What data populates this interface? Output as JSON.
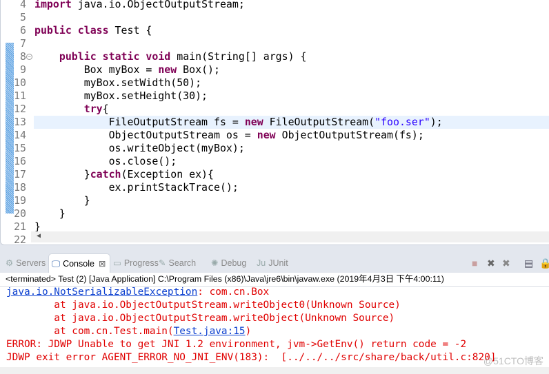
{
  "editor": {
    "current_line": 13,
    "lines": [
      {
        "n": "4",
        "segs": [
          [
            "kw",
            "import"
          ],
          [
            "",
            "java.io.ObjectOutputStream;"
          ]
        ],
        "sep": [
          " "
        ]
      },
      {
        "n": "5",
        "segs": []
      },
      {
        "n": "6",
        "segs": [
          [
            "kw",
            "public"
          ],
          [
            "",
            " "
          ],
          [
            "kw",
            "class"
          ],
          [
            "",
            " Test {"
          ]
        ]
      },
      {
        "n": "7",
        "segs": []
      },
      {
        "n": "8",
        "fold": true,
        "segs": [
          [
            "",
            "    "
          ],
          [
            "kw",
            "public"
          ],
          [
            "",
            " "
          ],
          [
            "kw",
            "static"
          ],
          [
            "",
            " "
          ],
          [
            "kw",
            "void"
          ],
          [
            "",
            " main(String[] args) {"
          ]
        ]
      },
      {
        "n": "9",
        "segs": [
          [
            "",
            "        Box myBox = "
          ],
          [
            "kw",
            "new"
          ],
          [
            "",
            " Box();"
          ]
        ]
      },
      {
        "n": "10",
        "segs": [
          [
            "",
            "        myBox.setWidth(50);"
          ]
        ]
      },
      {
        "n": "11",
        "segs": [
          [
            "",
            "        myBox.setHeight(30);"
          ]
        ]
      },
      {
        "n": "12",
        "segs": [
          [
            "",
            "        "
          ],
          [
            "kw",
            "try"
          ],
          [
            "",
            "{"
          ]
        ]
      },
      {
        "n": "13",
        "segs": [
          [
            "",
            "            FileOutputStream fs = "
          ],
          [
            "kw",
            "new"
          ],
          [
            "",
            " FileOutputStream("
          ],
          [
            "str",
            "\"foo.ser\""
          ],
          [
            "",
            ");"
          ]
        ]
      },
      {
        "n": "14",
        "segs": [
          [
            "",
            "            ObjectOutputStream os = "
          ],
          [
            "kw",
            "new"
          ],
          [
            "",
            " ObjectOutputStream(fs);"
          ]
        ]
      },
      {
        "n": "15",
        "segs": [
          [
            "",
            "            os.writeObject(myBox);"
          ]
        ]
      },
      {
        "n": "16",
        "segs": [
          [
            "",
            "            os.close();"
          ]
        ]
      },
      {
        "n": "17",
        "segs": [
          [
            "",
            "        }"
          ],
          [
            "kw",
            "catch"
          ],
          [
            "",
            "(Exception ex){"
          ]
        ]
      },
      {
        "n": "18",
        "segs": [
          [
            "",
            "            ex.printStackTrace();"
          ]
        ]
      },
      {
        "n": "19",
        "segs": [
          [
            "",
            "        }"
          ]
        ]
      },
      {
        "n": "20",
        "segs": [
          [
            "",
            "    }"
          ]
        ]
      },
      {
        "n": "21",
        "segs": [
          [
            "",
            "}"
          ]
        ]
      },
      {
        "n": "22",
        "segs": []
      }
    ]
  },
  "tabs": [
    {
      "label": "Servers",
      "icon": "servers-icon",
      "glyph": "⚙",
      "active": false
    },
    {
      "label": "Console",
      "icon": "console-icon",
      "glyph": "🖵",
      "active": true,
      "close": "⊠"
    },
    {
      "label": "Progress",
      "icon": "progress-icon",
      "glyph": "▭",
      "active": false
    },
    {
      "label": "Search",
      "icon": "search-icon",
      "glyph": "✎",
      "active": false
    },
    {
      "label": "Debug",
      "icon": "debug-icon",
      "glyph": "✺",
      "active": false
    },
    {
      "label": "JUnit",
      "icon": "junit-icon",
      "glyph": "Ju",
      "active": false
    }
  ],
  "toolbar": [
    {
      "name": "terminate-icon",
      "glyph": "■"
    },
    {
      "name": "remove-launch-icon",
      "glyph": "✖"
    },
    {
      "name": "remove-all-launches-icon",
      "glyph": "✖"
    },
    {
      "name": "clear-console-icon",
      "glyph": "▤"
    },
    {
      "name": "scroll-lock-icon",
      "glyph": "🔒"
    }
  ],
  "console": {
    "terminated": "<terminated> Test (2) [Java Application] C:\\Program Files (x86)\\Java\\jre6\\bin\\javaw.exe (2019年4月3日 下午4:00:11)",
    "exception_link": "java.io.NotSerializableException",
    "exception_rest": ": com.cn.Box",
    "stack": [
      "        at java.io.ObjectOutputStream.writeObject0(Unknown Source)",
      "        at java.io.ObjectOutputStream.writeObject(Unknown Source)"
    ],
    "main_prefix": "        at com.cn.Test.main(",
    "main_link": "Test.java:15",
    "main_suffix": ")",
    "error1": "ERROR: JDWP Unable to get JNI 1.2 environment, jvm->GetEnv() return code = -2",
    "error2": "JDWP exit error AGENT_ERROR_NO_JNI_ENV(183):  [../../../src/share/back/util.c:820]",
    "watermark": "@51CTO博客"
  },
  "colors": {
    "keyword": "#7f0055",
    "string": "#2a00ff",
    "error": "#e00000",
    "link": "#0b3fcf",
    "current_line": "#e8f2fe"
  }
}
